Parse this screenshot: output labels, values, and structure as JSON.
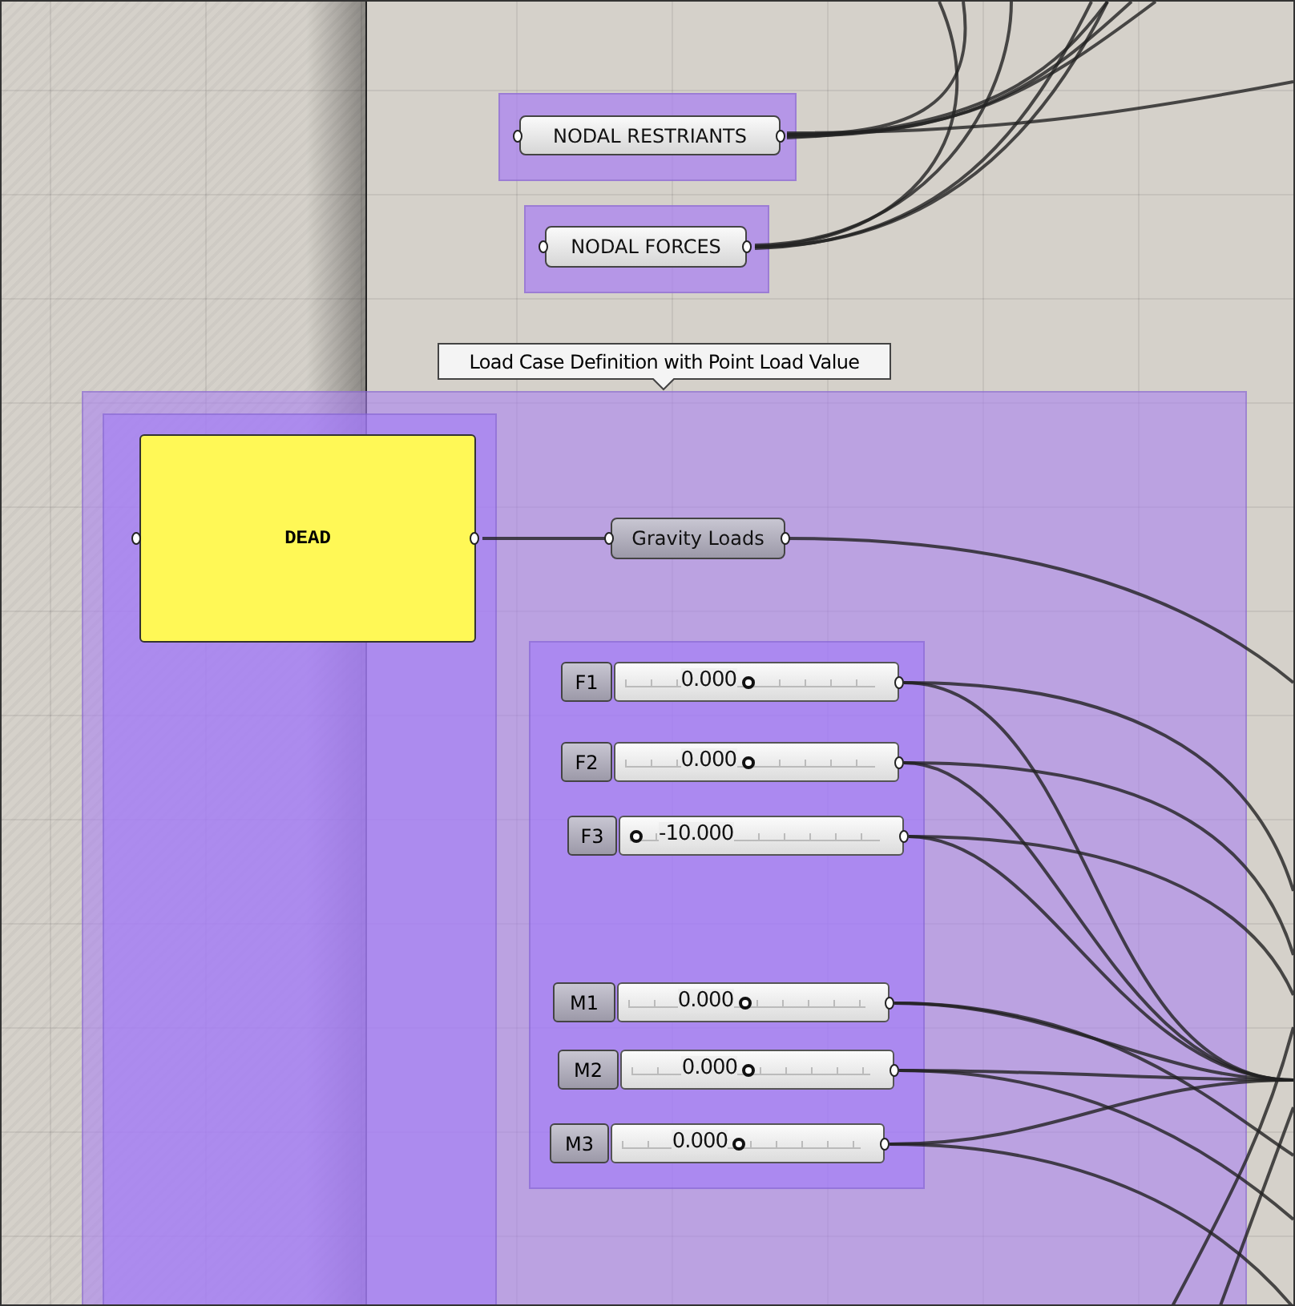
{
  "params": [
    {
      "label": "NODAL RESTRIANTS"
    },
    {
      "label": "NODAL FORCES"
    }
  ],
  "group_tooltip": "Load Case Definition with Point Load Value",
  "panel": {
    "text": "DEAD"
  },
  "relay": {
    "label": "Gravity Loads"
  },
  "sliders": [
    {
      "name": "F1",
      "value": "0.000",
      "level": 0.49
    },
    {
      "name": "F2",
      "value": "0.000",
      "level": 0.49
    },
    {
      "name": "F3",
      "value": "-10.000",
      "level": 0
    },
    {
      "name": "M1",
      "value": "0.000",
      "level": 0.49
    },
    {
      "name": "M2",
      "value": "0.000",
      "level": 0.49
    },
    {
      "name": "M3",
      "value": "0.000",
      "level": 0.49
    }
  ]
}
